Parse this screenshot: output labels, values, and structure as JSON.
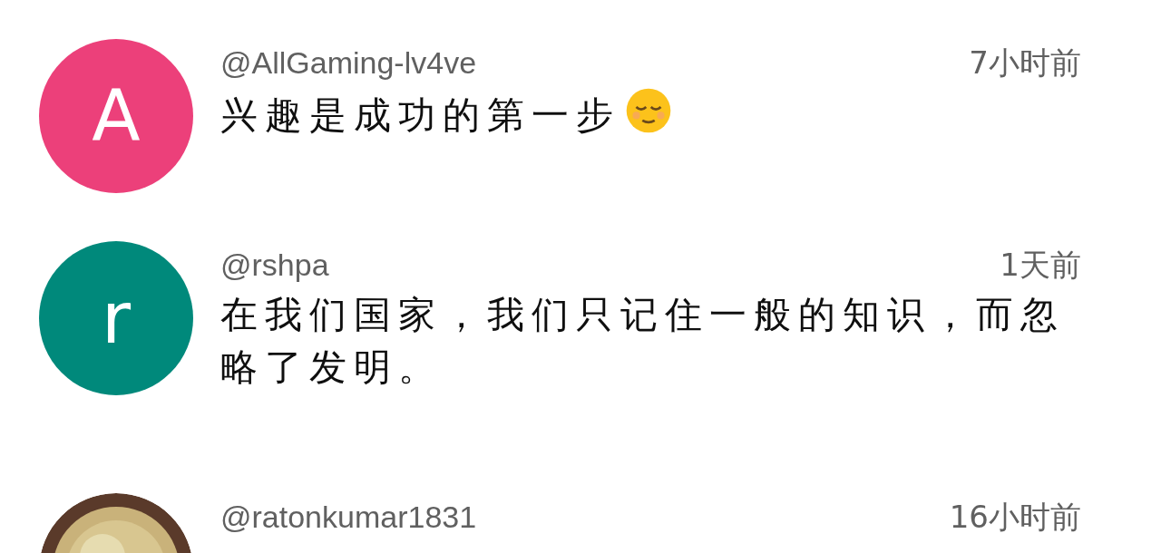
{
  "comments": [
    {
      "avatar": {
        "kind": "letter",
        "letter": "A",
        "color": "#ec407a"
      },
      "username": "@AllGaming-lv4ve",
      "time": "7小时前",
      "text": "兴趣是成功的第一步",
      "emoji_after": true
    },
    {
      "avatar": {
        "kind": "letter",
        "letter": "r",
        "color": "#00897b"
      },
      "username": "@rshpa",
      "time": "1天前",
      "text": "在我们国家，我们只记住一般的知识，而忽略了发明。",
      "emoji_after": false
    },
    {
      "username": "@ratonkumar1831",
      "time": "16小时前"
    }
  ]
}
